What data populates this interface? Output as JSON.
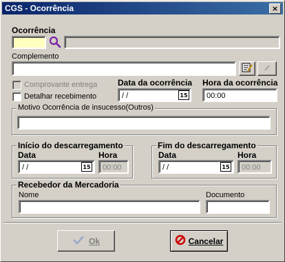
{
  "window": {
    "title": "CGS - Ocorrência",
    "close_label": "×"
  },
  "ocorrencia": {
    "label": "Ocorrência",
    "code": "",
    "description": ""
  },
  "complemento": {
    "label": "Complemento",
    "value": ""
  },
  "checks": {
    "comprovante": {
      "label": "Comprovante entrega",
      "checked": false
    },
    "detalhar": {
      "label": "Detalhar recebimento",
      "checked": false
    }
  },
  "data_ocorrencia": {
    "label": "Data da ocorrência",
    "value": " /  /",
    "cal_icon": "15"
  },
  "hora_ocorrencia": {
    "label": "Hora da ocorrência",
    "value": "00:00"
  },
  "motivo": {
    "label": "Motivo Ocorrência de insucesso(Outros)",
    "value": ""
  },
  "inicio": {
    "title": "Início  do descarregamento",
    "data_label": "Data",
    "data_value": " /  /",
    "cal_icon": "15",
    "hora_label": "Hora",
    "hora_value": "00:00"
  },
  "fim": {
    "title": "Fim do descarregamento",
    "data_label": "Data",
    "data_value": " /  /",
    "cal_icon": "15",
    "hora_label": "Hora",
    "hora_value": "00:00"
  },
  "recebedor": {
    "title": "Recebedor da Mercadoria",
    "nome_label": "Nome",
    "nome_value": "",
    "documento_label": "Documento",
    "documento_value": ""
  },
  "buttons": {
    "ok_label": "Ok",
    "cancel_label": "Cancelar"
  }
}
